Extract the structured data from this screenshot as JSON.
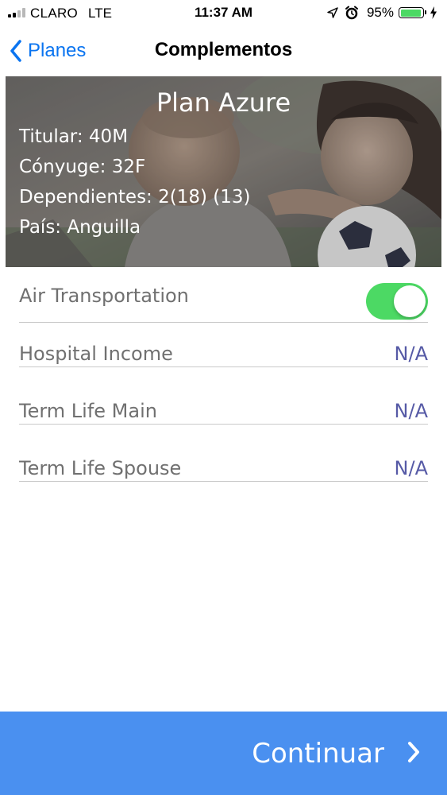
{
  "status_bar": {
    "carrier": "CLARO",
    "network": "LTE",
    "time": "11:37 AM",
    "battery_percent": "95%",
    "battery_level": 0.95,
    "icons": [
      "signal-bars-icon",
      "location-arrow-icon",
      "alarm-clock-icon",
      "battery-icon",
      "charging-bolt-icon"
    ]
  },
  "nav": {
    "back_label": "Planes",
    "title": "Complementos"
  },
  "plan": {
    "name": "Plan Azure",
    "details": [
      "Titular: 40M",
      "Cónyuge: 32F",
      "Dependientes: 2(18) (13)",
      "País: Anguilla"
    ]
  },
  "options": [
    {
      "label": "Air Transportation",
      "type": "toggle",
      "on": true
    },
    {
      "label": "Hospital Income",
      "value": "N/A"
    },
    {
      "label": "Term Life Main",
      "value": "N/A"
    },
    {
      "label": "Term Life Spouse",
      "value": "N/A"
    }
  ],
  "footer": {
    "continue_label": "Continuar"
  },
  "colors": {
    "accent": "#0a74f0",
    "toggle_on": "#4cd964",
    "value_text": "#565aa6",
    "footer_bg": "#4a90f0"
  }
}
